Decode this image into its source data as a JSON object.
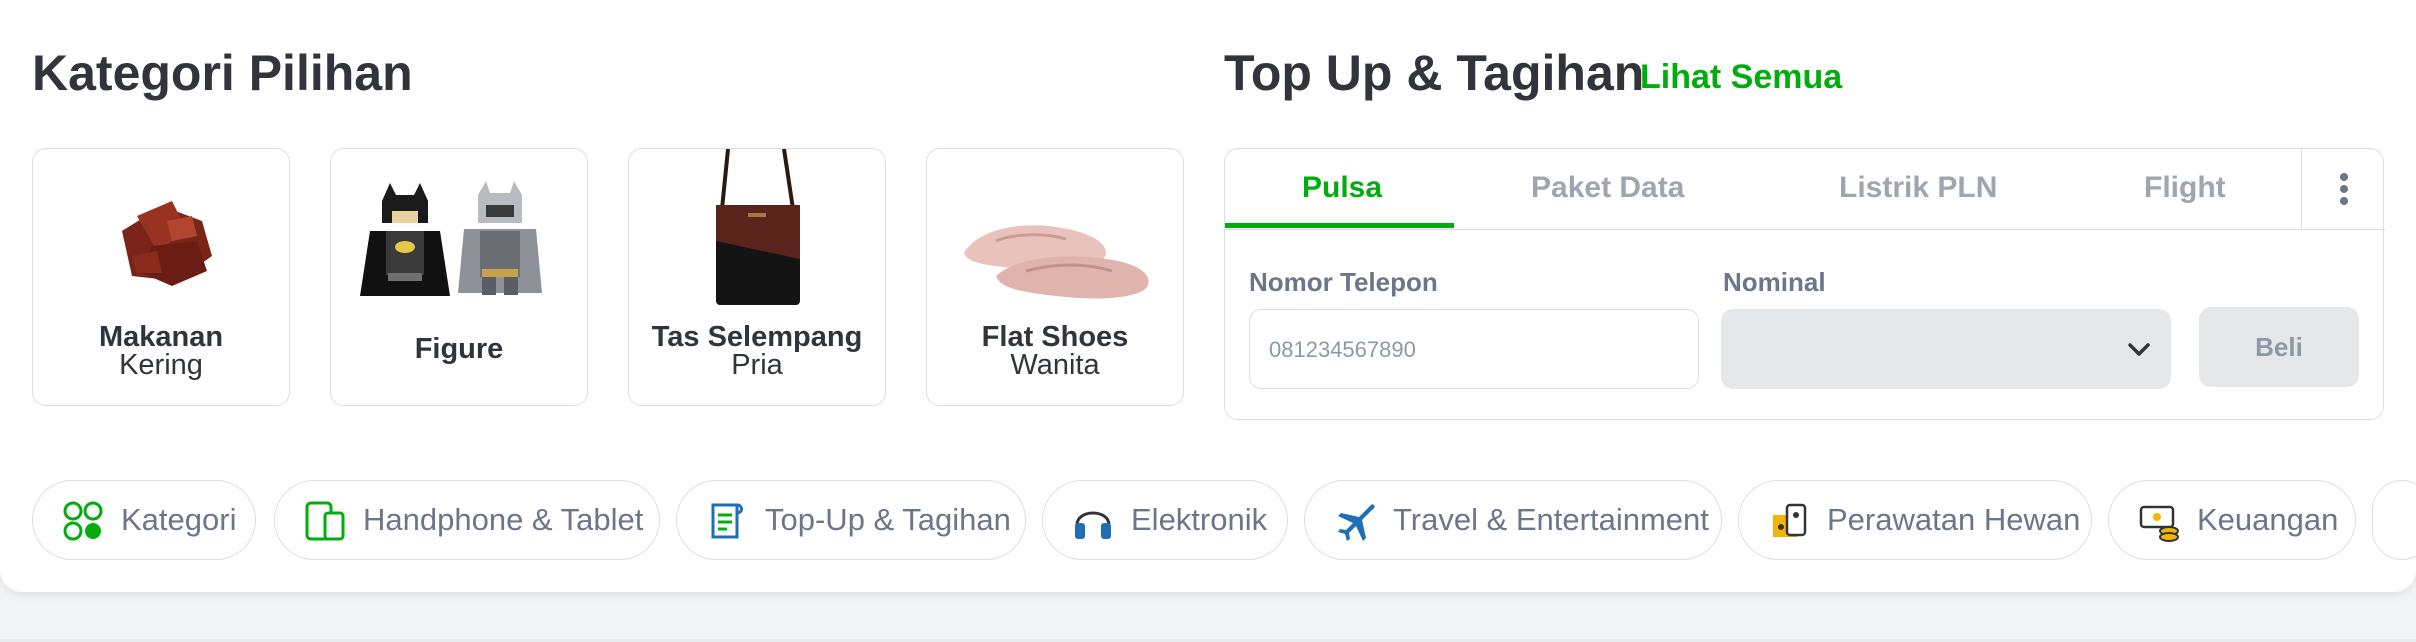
{
  "kategori": {
    "title": "Kategori Pilihan",
    "tiles": [
      {
        "line1": "Makanan",
        "line2": "Kering",
        "icon": "dried-meat-image"
      },
      {
        "line1": "Figure",
        "line2": "",
        "icon": "lego-figure-image"
      },
      {
        "line1": "Tas Selempang",
        "line2": "Pria",
        "icon": "shoulder-bag-image"
      },
      {
        "line1": "Flat Shoes",
        "line2": "Wanita",
        "icon": "flat-shoes-image"
      }
    ]
  },
  "topup": {
    "title": "Top Up & Tagihan",
    "link": "Lihat Semua",
    "tabs": [
      "Pulsa",
      "Paket Data",
      "Listrik PLN",
      "Flight"
    ],
    "active_tab": "Pulsa",
    "phone_label": "Nomor Telepon",
    "phone_placeholder": "081234567890",
    "phone_value": "",
    "nominal_label": "Nominal",
    "nominal_value": "",
    "buy_label": "Beli"
  },
  "chips": [
    {
      "label": "Kategori",
      "icon": "grid-categories-icon"
    },
    {
      "label": "Handphone & Tablet",
      "icon": "phone-tablet-icon"
    },
    {
      "label": "Top-Up & Tagihan",
      "icon": "bill-receipt-icon"
    },
    {
      "label": "Elektronik",
      "icon": "headphones-icon"
    },
    {
      "label": "Travel & Entertainment",
      "icon": "airplane-icon"
    },
    {
      "label": "Perawatan Hewan",
      "icon": "pet-care-icon"
    },
    {
      "label": "Keuangan",
      "icon": "money-coins-icon"
    }
  ],
  "colors": {
    "accent": "#03ac0e",
    "text": "#31353b",
    "muted": "#6d7588",
    "border": "#dbdee2",
    "disabled_bg": "#e5e7e9"
  }
}
